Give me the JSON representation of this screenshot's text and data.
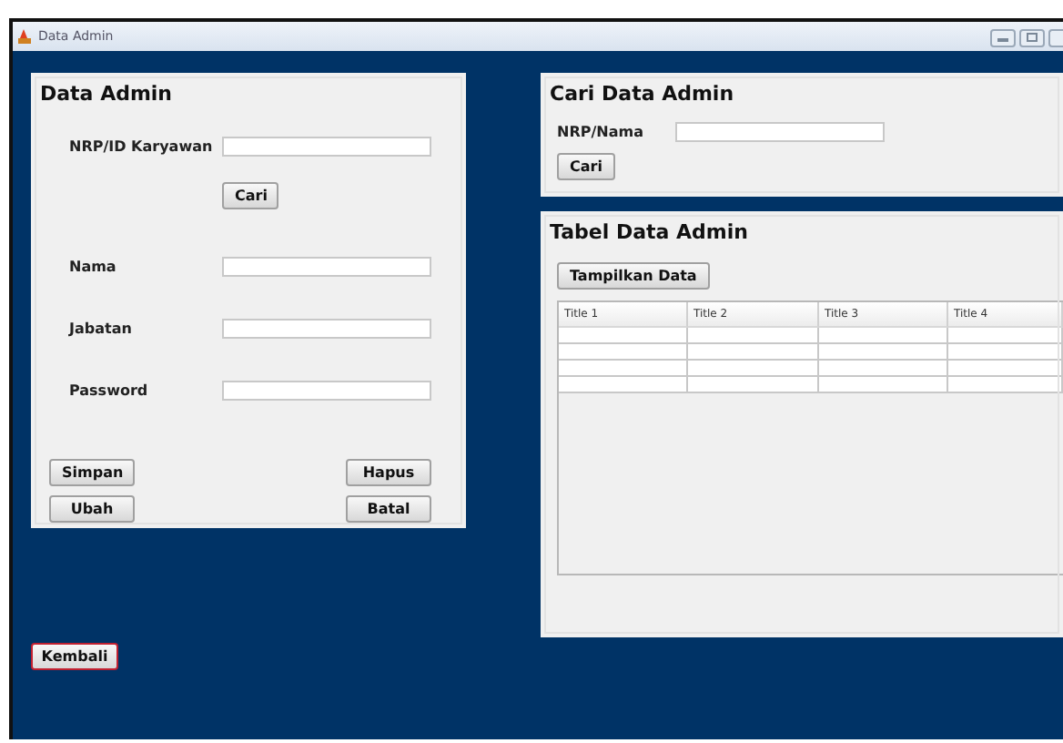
{
  "window": {
    "title": "Data Admin"
  },
  "data_admin": {
    "title": "Data Admin",
    "fields": [
      {
        "label": "NRP/ID Karyawan"
      },
      {
        "label": "Nama"
      },
      {
        "label": "Jabatan"
      },
      {
        "label": "Password"
      }
    ],
    "search_button": "Cari",
    "buttons": [
      "Simpan",
      "Hapus",
      "Ubah",
      "Batal"
    ]
  },
  "search": {
    "title": "Cari Data Admin",
    "label": "NRP/Nama",
    "button": "Cari"
  },
  "table_panel": {
    "title": "Tabel Data Admin",
    "button": "Tampilkan Data",
    "columns": [
      "Title 1",
      "Title 2",
      "Title 3",
      "Title 4"
    ]
  },
  "back_button": {
    "label": "Kembali",
    "focused": true
  }
}
